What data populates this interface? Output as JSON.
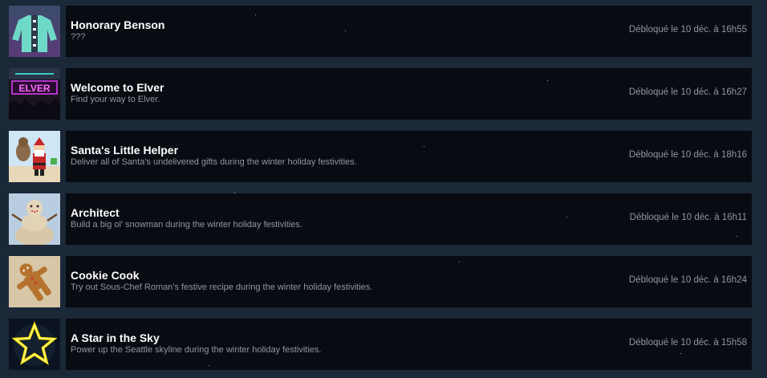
{
  "achievements": [
    {
      "title": "Honorary Benson",
      "description": "???",
      "unlocked": "Débloqué le 10 déc. à 16h55",
      "icon": "jacket-icon"
    },
    {
      "title": "Welcome to Elver",
      "description": "Find your way to Elver.",
      "unlocked": "Débloqué le 10 déc. à 16h27",
      "icon": "elver-sign-icon",
      "icon_text": "ELVER"
    },
    {
      "title": "Santa's Little Helper",
      "description": "Deliver all of Santa's undelivered gifts during the winter holiday festivities.",
      "unlocked": "Débloqué le 10 déc. à 18h16",
      "icon": "santa-icon"
    },
    {
      "title": "Architect",
      "description": "Build a big ol' snowman during the winter holiday festivities.",
      "unlocked": "Débloqué le 10 déc. à 16h11",
      "icon": "snowman-icon"
    },
    {
      "title": "Cookie Cook",
      "description": "Try out Sous-Chef Roman's festive recipe during the winter holiday festivities.",
      "unlocked": "Débloqué le 10 déc. à 16h24",
      "icon": "gingerbread-cookie-icon"
    },
    {
      "title": "A Star in the Sky",
      "description": "Power up the Seattle skyline during the winter holiday festivities.",
      "unlocked": "Débloqué le 10 déc. à 15h58",
      "icon": "neon-star-icon"
    }
  ],
  "colors": {
    "page_background": "#1b2838",
    "card_background": "#080b11",
    "title": "#ffffff",
    "secondary_text": "#8f98a0",
    "neon_star": "#ffe600",
    "neon_sign": "#e040fb"
  }
}
